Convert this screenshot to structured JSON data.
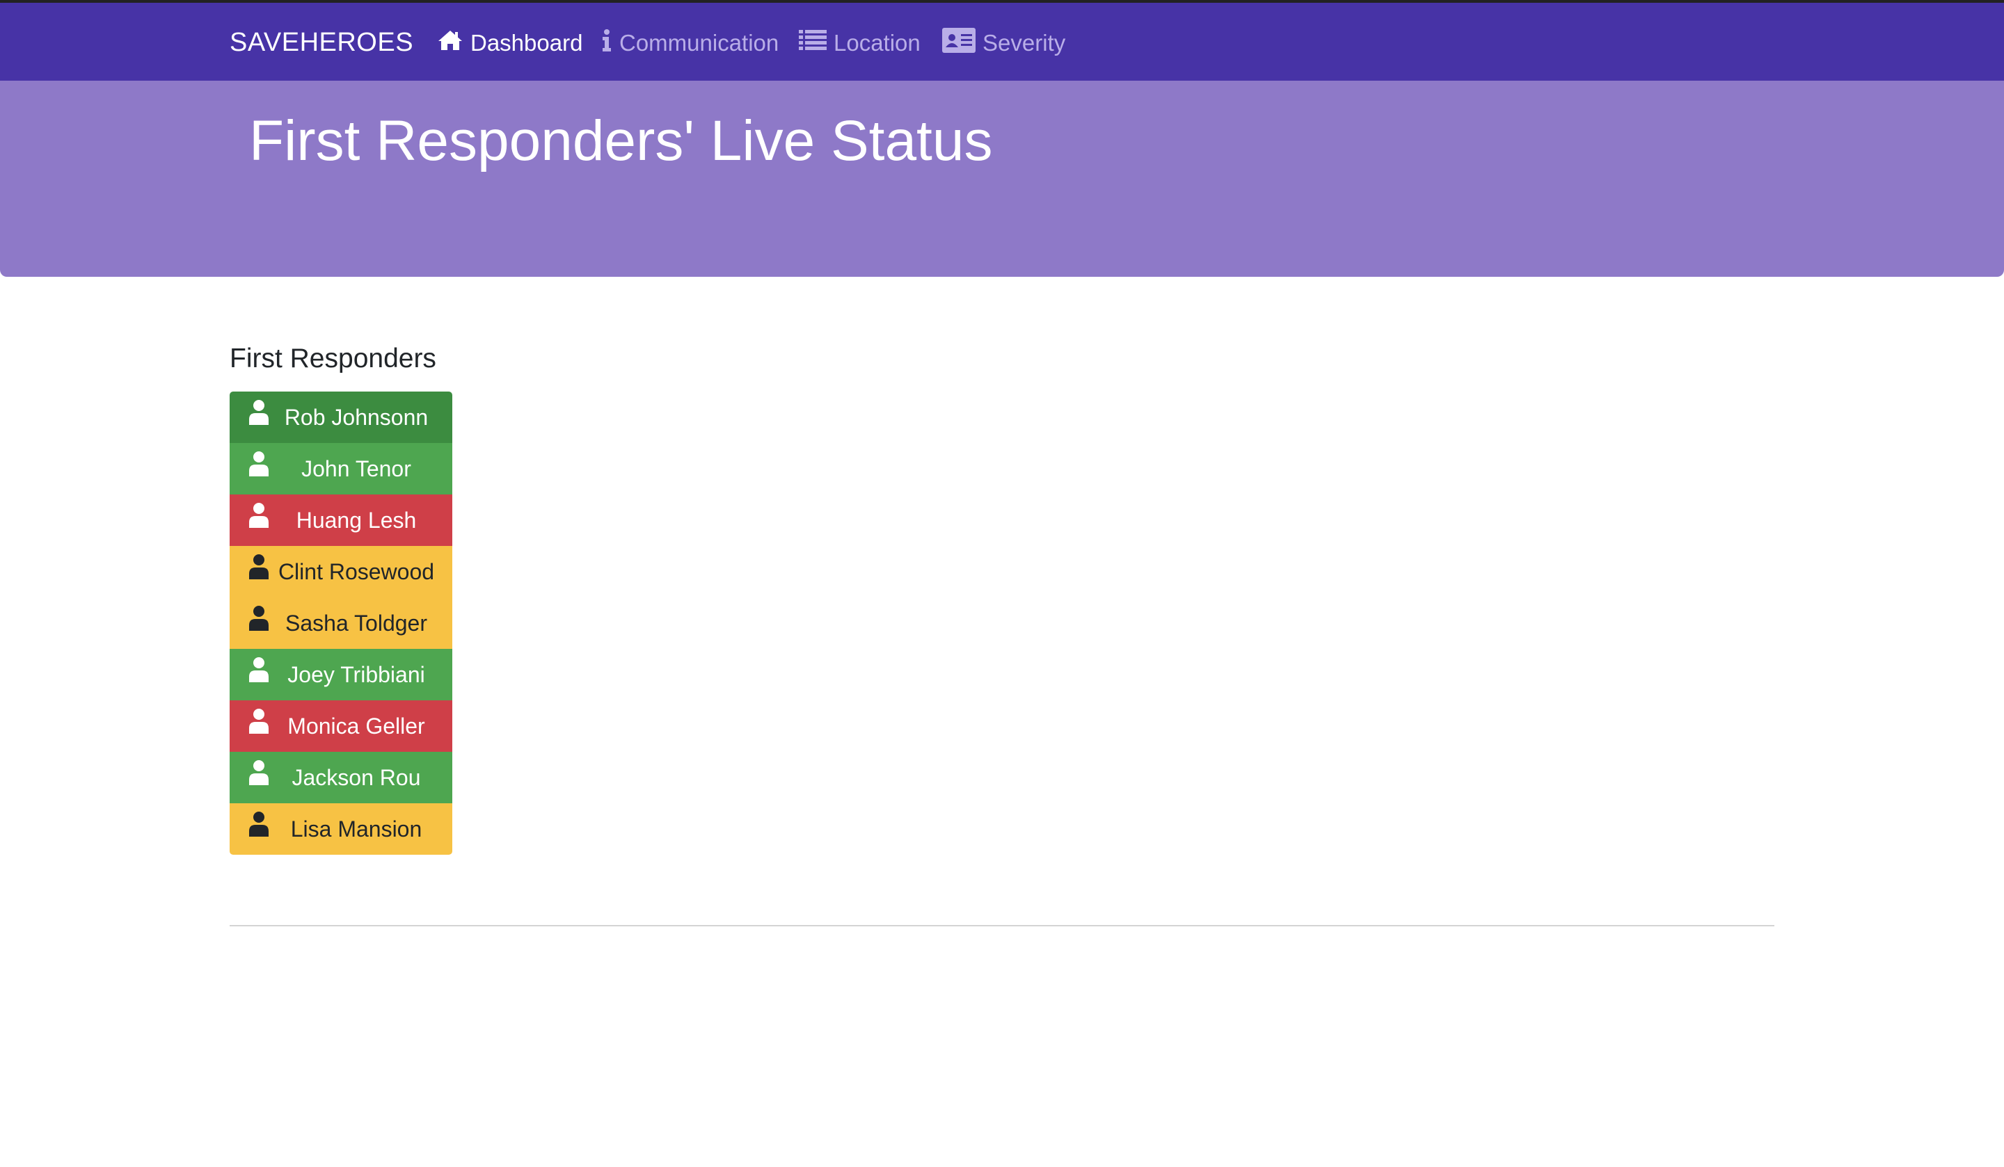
{
  "navbar": {
    "brand": "SAVEHEROES",
    "items": [
      {
        "label": "Dashboard",
        "icon": "home-icon",
        "active": true
      },
      {
        "label": "Communication",
        "icon": "info-icon",
        "active": false
      },
      {
        "label": "Location",
        "icon": "list-icon",
        "active": false
      },
      {
        "label": "Severity",
        "icon": "id-card-icon",
        "active": false
      }
    ]
  },
  "hero": {
    "title": "First Responders' Live Status"
  },
  "responders": {
    "title": "First Responders",
    "items": [
      {
        "name": "Rob Johnsonn",
        "status": "active-success",
        "bg": "#3c8c40",
        "fg": "#ffffff"
      },
      {
        "name": "John Tenor",
        "status": "success",
        "bg": "#4ea650",
        "fg": "#ffffff"
      },
      {
        "name": "Huang Lesh",
        "status": "danger",
        "bg": "#cf3f48",
        "fg": "#ffffff"
      },
      {
        "name": "Clint Rosewood",
        "status": "warning",
        "bg": "#f7c244",
        "fg": "#212529"
      },
      {
        "name": "Sasha Toldger",
        "status": "warning",
        "bg": "#f7c244",
        "fg": "#212529"
      },
      {
        "name": "Joey Tribbiani",
        "status": "success",
        "bg": "#4ea650",
        "fg": "#ffffff"
      },
      {
        "name": "Monica Geller",
        "status": "danger",
        "bg": "#cf3f48",
        "fg": "#ffffff"
      },
      {
        "name": "Jackson Rou",
        "status": "success",
        "bg": "#4ea650",
        "fg": "#ffffff"
      },
      {
        "name": "Lisa Mansion",
        "status": "warning",
        "bg": "#f7c244",
        "fg": "#212529"
      }
    ]
  },
  "colors": {
    "navbar": "#4733a6",
    "hero": "#8e79c8",
    "nav_inactive": "#b9aee8"
  }
}
